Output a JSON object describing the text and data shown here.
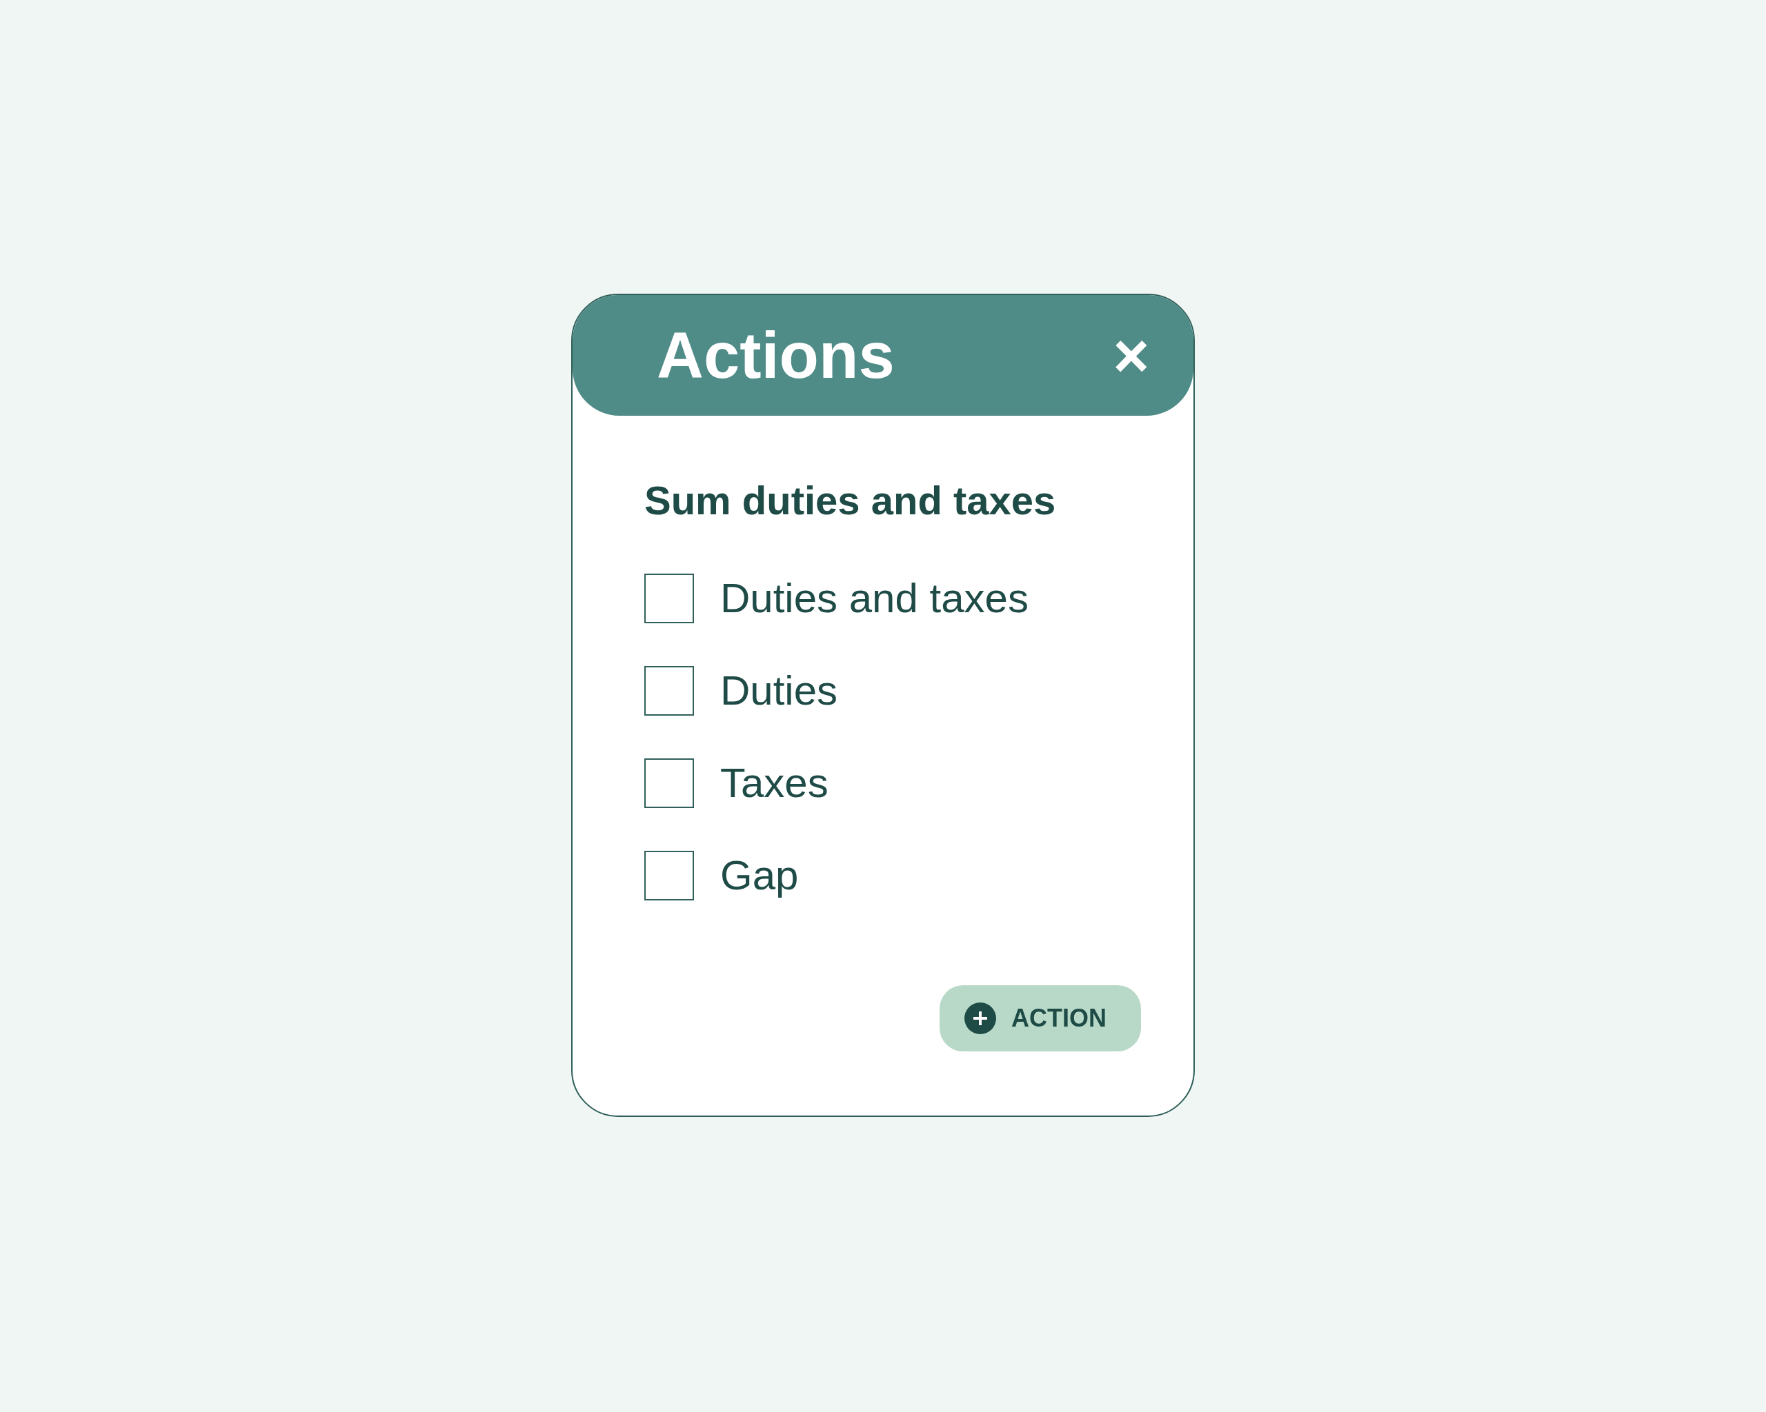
{
  "dialog": {
    "title": "Actions",
    "close": "×"
  },
  "section": {
    "heading": "Sum duties and taxes",
    "options": [
      {
        "label": "Duties and taxes",
        "checked": false
      },
      {
        "label": "Duties",
        "checked": false
      },
      {
        "label": "Taxes",
        "checked": false
      },
      {
        "label": "Gap",
        "checked": false
      }
    ]
  },
  "button": {
    "label": "ACTION"
  }
}
